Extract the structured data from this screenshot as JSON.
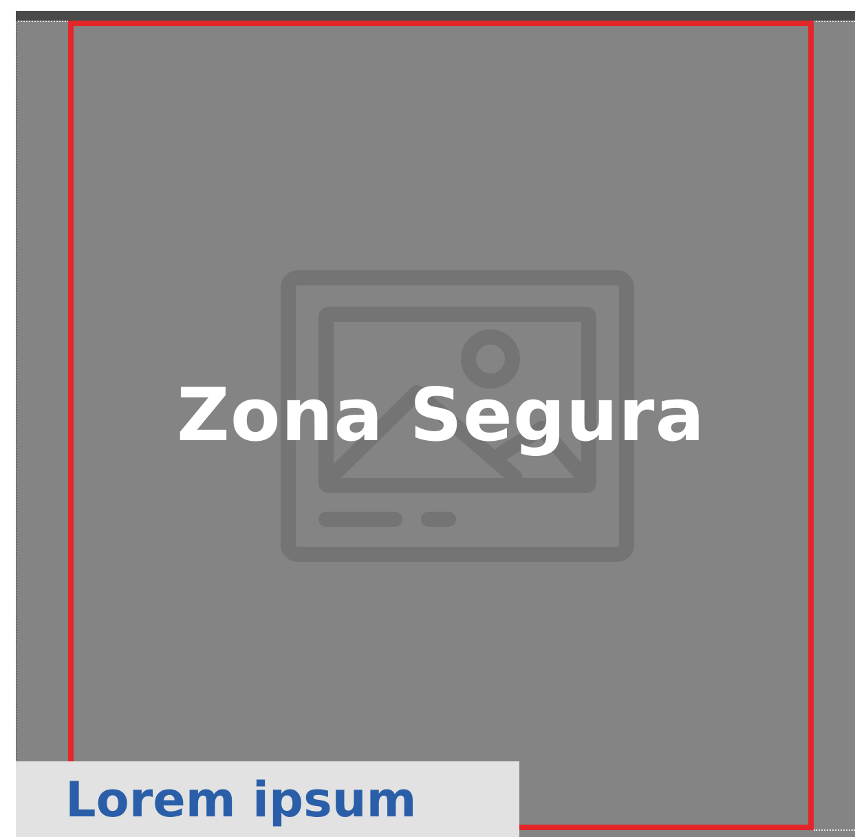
{
  "safe_zone": {
    "label": "Zona Segura",
    "border_color": "#e3262a"
  },
  "placeholder": {
    "icon": "image-placeholder-icon"
  },
  "caption": {
    "text": "Lorem ipsum",
    "color": "#2a5ea8"
  },
  "colors": {
    "canvas": "#848484",
    "icon": "#747474",
    "caption_bg": "#e2e2e2"
  }
}
